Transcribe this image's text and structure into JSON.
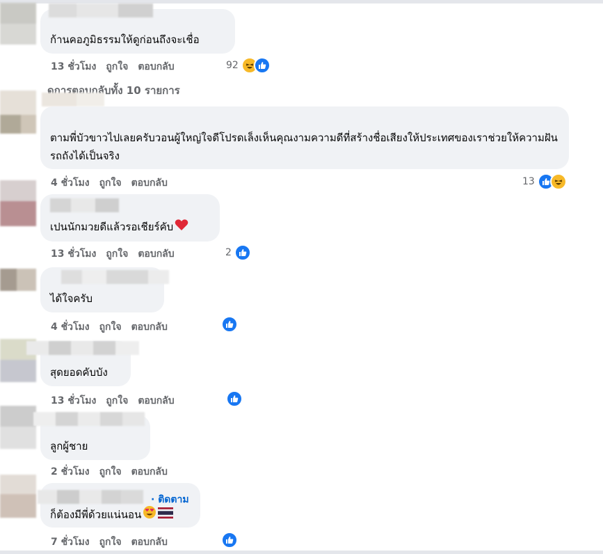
{
  "colors": {
    "bubble": "#f0f2f5",
    "meta": "#65676b",
    "like": "#1877f2",
    "haha": "#f7b928",
    "follow": "#0064d1"
  },
  "actions": {
    "like": "ถูกใจ",
    "reply": "ตอบกลับ"
  },
  "replies_link": "ดการตอบกลับทั้ง 10 รายการ",
  "comments": [
    {
      "text": "ก้านคอภูมิธรรมให้ดูก่อนถึงจะเชื่อ",
      "time": "13 ชั่วโมง",
      "reaction_count": "92",
      "reactions": [
        "haha-icon",
        "like-icon"
      ]
    },
    {
      "text": "ตามพี่บัวขาวไปเลยครับวอนผู้ใหญ่ใจดีโปรดเล็งเห็นคุณงามความดีที่สร้างชื่อเสียงให้ประเทศของเราช่วยให้ความฝันรถถังได้เป็นจริง",
      "time": "4 ชั่วโมง",
      "reaction_count": "13",
      "reactions": [
        "like-icon",
        "haha-icon"
      ]
    },
    {
      "text": "เปนนักมวยดีแล้วรอเชียร์คับ",
      "emoji": "heart-emoji",
      "time": "13 ชั่วโมง",
      "reaction_count": "2",
      "reactions": [
        "like-icon"
      ]
    },
    {
      "text": "ได้ใจครับ",
      "time": "4 ชั่วโมง",
      "reaction_count": "",
      "reactions": [
        "like-icon"
      ]
    },
    {
      "text": "สุดยอดคับบัง",
      "time": "13 ชั่วโมง",
      "reaction_count": "",
      "reactions": [
        "like-icon"
      ]
    },
    {
      "text": "ลูกผู้ชาย",
      "time": "2 ชั่วโมง",
      "reaction_count": "",
      "reactions": []
    },
    {
      "text": "ก็ต้องมีพี่ด้วยแน่นอน",
      "follow": "· ติดตาม",
      "emoji": "heart-eyes-emoji thai-flag-emoji",
      "time": "7 ชั่วโมง",
      "reaction_count": "",
      "reactions": [
        "like-icon"
      ]
    }
  ]
}
